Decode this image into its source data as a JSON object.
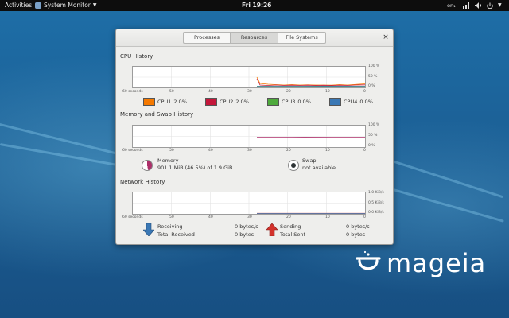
{
  "topbar": {
    "activities": "Activities",
    "app_name": "System Monitor",
    "clock": "Fri 19:26",
    "language": "en₁",
    "system_icons": [
      "network-icon",
      "volume-icon",
      "power-icon"
    ]
  },
  "window": {
    "tabs": [
      {
        "label": "Processes",
        "active": false
      },
      {
        "label": "Resources",
        "active": true
      },
      {
        "label": "File Systems",
        "active": false
      }
    ],
    "close_symbol": "×"
  },
  "cpu": {
    "title": "CPU History",
    "y_ticks": [
      "100 %",
      "50 %",
      "0 %"
    ],
    "x_ticks": [
      "60 seconds",
      "50",
      "40",
      "30",
      "20",
      "10",
      "0"
    ],
    "legend": [
      {
        "label": "CPU1",
        "value": "2.0%",
        "color": "#f57900"
      },
      {
        "label": "CPU2",
        "value": "2.0%",
        "color": "#c4173a"
      },
      {
        "label": "CPU3",
        "value": "0.0%",
        "color": "#4eaa3c"
      },
      {
        "label": "CPU4",
        "value": "0.0%",
        "color": "#3a78b5"
      }
    ]
  },
  "memory": {
    "title": "Memory and Swap History",
    "y_ticks": [
      "100 %",
      "50 %",
      "0 %"
    ],
    "x_ticks": [
      "60 seconds",
      "50",
      "40",
      "30",
      "20",
      "10",
      "0"
    ],
    "memory_label": "Memory",
    "memory_value": "901.1 MiB (46.5%) of 1.9 GiB",
    "memory_percent": 46.5,
    "memory_color": "#ad2f6a",
    "swap_label": "Swap",
    "swap_value": "not available",
    "swap_color": "#2e3436"
  },
  "network": {
    "title": "Network History",
    "y_ticks": [
      "1.0 KiB/s",
      "0.5 KiB/s",
      "0.0 KiB/s"
    ],
    "x_ticks": [
      "60 seconds",
      "50",
      "40",
      "30",
      "20",
      "10",
      "0"
    ],
    "receiving_label": "Receiving",
    "receiving_value": "0 bytes/s",
    "total_received_label": "Total Received",
    "total_received_value": "0 bytes",
    "sending_label": "Sending",
    "sending_value": "0 bytes/s",
    "total_sent_label": "Total Sent",
    "total_sent_value": "0 bytes",
    "receiving_color": "#3a78b5",
    "sending_color": "#d3322c"
  },
  "branding": {
    "logo_text": "mageia"
  }
}
